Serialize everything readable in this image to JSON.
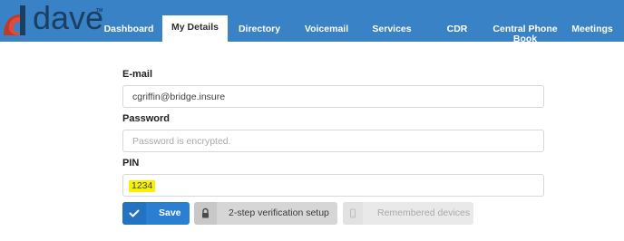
{
  "brand": {
    "logo_text": "dave",
    "logo_mark": "TM",
    "colors": {
      "navbar": "#3a82c6",
      "logo_accent": "#c0392b",
      "logo_text": "#1b3f63",
      "primary_button": "#2a7fd2",
      "highlight": "#f7f200"
    }
  },
  "nav": {
    "items": [
      {
        "label": "Dashboard",
        "active": false
      },
      {
        "label": "My Details",
        "active": true
      },
      {
        "label": "Directory",
        "active": false
      },
      {
        "label": "Voicemail",
        "active": false
      },
      {
        "label": "Services",
        "active": false
      },
      {
        "label": "CDR",
        "active": false
      },
      {
        "label": "Central Phone Book",
        "active": false
      },
      {
        "label": "Meetings",
        "active": false
      }
    ]
  },
  "form": {
    "email": {
      "label": "E-mail",
      "value": "cgriffin@bridge.insure"
    },
    "password": {
      "label": "Password",
      "placeholder": "Password is encrypted.",
      "value": ""
    },
    "pin": {
      "label": "PIN",
      "value": "1234"
    }
  },
  "buttons": {
    "save": {
      "label": "Save",
      "icon": "check-icon",
      "enabled": true
    },
    "two_step": {
      "label": "2-step verification setup",
      "icon": "lock-icon",
      "enabled": true
    },
    "remembered": {
      "label": "Remembered devices",
      "icon": "mobile-phone-icon",
      "enabled": false
    }
  }
}
